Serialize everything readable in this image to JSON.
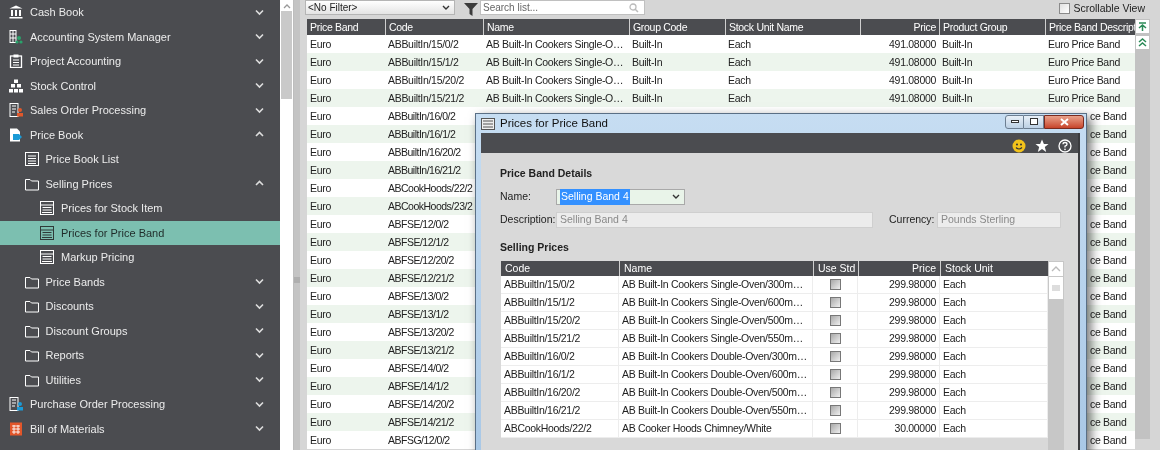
{
  "sidebar": {
    "items": [
      {
        "label": "Cash Book",
        "expanded": false,
        "selected": false
      },
      {
        "label": "Accounting System Manager",
        "expanded": false,
        "selected": false
      },
      {
        "label": "Project Accounting",
        "expanded": false,
        "selected": false
      },
      {
        "label": "Stock Control",
        "expanded": false,
        "selected": false
      },
      {
        "label": "Sales Order Processing",
        "expanded": false,
        "selected": false
      },
      {
        "label": "Price Book",
        "expanded": true,
        "selected": false,
        "children": [
          {
            "label": "Price Book List",
            "selected": false
          },
          {
            "label": "Selling Prices",
            "expanded": true,
            "selected": false,
            "children": [
              {
                "label": "Prices for Stock Item",
                "selected": false
              },
              {
                "label": "Prices for Price Band",
                "selected": true
              },
              {
                "label": "Markup Pricing",
                "selected": false
              }
            ]
          },
          {
            "label": "Price Bands",
            "expanded": false,
            "selected": false
          },
          {
            "label": "Discounts",
            "expanded": false,
            "selected": false
          },
          {
            "label": "Discount Groups",
            "expanded": false,
            "selected": false
          },
          {
            "label": "Reports",
            "expanded": false,
            "selected": false
          },
          {
            "label": "Utilities",
            "expanded": false,
            "selected": false
          }
        ]
      },
      {
        "label": "Purchase Order Processing",
        "expanded": false,
        "selected": false
      },
      {
        "label": "Bill of Materials",
        "expanded": false,
        "selected": false
      }
    ]
  },
  "toolbar": {
    "filter": "<No Filter>",
    "search": {
      "placeholder": "Search list..."
    },
    "scrollable_view": {
      "label": "Scrollable View",
      "checked": false
    }
  },
  "table": {
    "columns": [
      "Price Band",
      "Code",
      "Name",
      "Group Code",
      "Stock Unit Name",
      "Price",
      "Product Group",
      "Price Band Descript"
    ],
    "rows": [
      {
        "kind": "full",
        "cells": [
          "Euro",
          "ABBuiltIn/15/0/2",
          "AB Built-In Cookers Single-O…",
          "Built-In",
          "Each",
          "491.08000",
          "Built-In",
          "Euro Price Band"
        ]
      },
      {
        "kind": "full",
        "cells": [
          "Euro",
          "ABBuiltIn/15/1/2",
          "AB Built-In Cookers Single-O…",
          "Built-In",
          "Each",
          "491.08000",
          "Built-In",
          "Euro Price Band"
        ]
      },
      {
        "kind": "full",
        "cells": [
          "Euro",
          "ABBuiltIn/15/20/2",
          "AB Built-In Cookers Single-O…",
          "Built-In",
          "Each",
          "491.08000",
          "Built-In",
          "Euro Price Band"
        ]
      },
      {
        "kind": "full",
        "cells": [
          "Euro",
          "ABBuiltIn/15/21/2",
          "AB Built-In Cookers Single-O…",
          "Built-In",
          "Each",
          "491.08000",
          "Built-In",
          "Euro Price Band"
        ]
      },
      {
        "kind": "covered",
        "cells": [
          "Euro",
          "ABBuiltIn/16/0/2",
          "ce Band"
        ]
      },
      {
        "kind": "covered",
        "cells": [
          "Euro",
          "ABBuiltIn/16/1/2",
          "ce Band"
        ]
      },
      {
        "kind": "covered",
        "cells": [
          "Euro",
          "ABBuiltIn/16/20/2",
          "ce Band"
        ]
      },
      {
        "kind": "covered",
        "cells": [
          "Euro",
          "ABBuiltIn/16/21/2",
          "ce Band"
        ]
      },
      {
        "kind": "covered",
        "cells": [
          "Euro",
          "ABCookHoods/22/2",
          "ce Band"
        ]
      },
      {
        "kind": "covered",
        "cells": [
          "Euro",
          "ABCookHoods/23/2",
          "ce Band"
        ]
      },
      {
        "kind": "covered",
        "cells": [
          "Euro",
          "ABFSE/12/0/2",
          "ce Band"
        ]
      },
      {
        "kind": "covered",
        "cells": [
          "Euro",
          "ABFSE/12/1/2",
          "ce Band"
        ]
      },
      {
        "kind": "covered",
        "cells": [
          "Euro",
          "ABFSE/12/20/2",
          "ce Band"
        ]
      },
      {
        "kind": "covered",
        "cells": [
          "Euro",
          "ABFSE/12/21/2",
          "ce Band"
        ]
      },
      {
        "kind": "covered",
        "cells": [
          "Euro",
          "ABFSE/13/0/2",
          "ce Band"
        ]
      },
      {
        "kind": "covered",
        "cells": [
          "Euro",
          "ABFSE/13/1/2",
          "ce Band"
        ]
      },
      {
        "kind": "covered",
        "cells": [
          "Euro",
          "ABFSE/13/20/2",
          "ce Band"
        ]
      },
      {
        "kind": "covered",
        "cells": [
          "Euro",
          "ABFSE/13/21/2",
          "ce Band"
        ]
      },
      {
        "kind": "covered",
        "cells": [
          "Euro",
          "ABFSE/14/0/2",
          "ce Band"
        ]
      },
      {
        "kind": "covered",
        "cells": [
          "Euro",
          "ABFSE/14/1/2",
          "ce Band"
        ]
      },
      {
        "kind": "covered",
        "cells": [
          "Euro",
          "ABFSE/14/20/2",
          "ce Band"
        ]
      },
      {
        "kind": "covered",
        "cells": [
          "Euro",
          "ABFSE/14/21/2",
          "ce Band"
        ]
      },
      {
        "kind": "covered",
        "cells": [
          "Euro",
          "ABFSG/12/0/2",
          "ce Band"
        ]
      }
    ]
  },
  "dialog": {
    "title": "Prices for Price Band",
    "section_details": "Price Band Details",
    "name": {
      "label": "Name:",
      "value": "Selling Band 4",
      "text_selected": true
    },
    "description": {
      "label": "Description:",
      "value": "Selling Band 4"
    },
    "currency": {
      "label": "Currency:",
      "value": "Pounds Sterling"
    },
    "section_prices": "Selling Prices",
    "columns": [
      "Code",
      "Name",
      "Use Std",
      "Price",
      "Stock Unit"
    ],
    "rows": [
      {
        "code": "ABBuiltIn/15/0/2",
        "name": "AB Built-In Cookers Single-Oven/300m…",
        "use_std": false,
        "price": "299.98000",
        "unit": "Each"
      },
      {
        "code": "ABBuiltIn/15/1/2",
        "name": "AB Built-In Cookers Single-Oven/600m…",
        "use_std": false,
        "price": "299.98000",
        "unit": "Each"
      },
      {
        "code": "ABBuiltIn/15/20/2",
        "name": "AB Built-In Cookers Single-Oven/500m…",
        "use_std": false,
        "price": "299.98000",
        "unit": "Each"
      },
      {
        "code": "ABBuiltIn/15/21/2",
        "name": "AB Built-In Cookers Single-Oven/550m…",
        "use_std": false,
        "price": "299.98000",
        "unit": "Each"
      },
      {
        "code": "ABBuiltIn/16/0/2",
        "name": "AB Built-In Cookers Double-Oven/300m…",
        "use_std": false,
        "price": "299.98000",
        "unit": "Each"
      },
      {
        "code": "ABBuiltIn/16/1/2",
        "name": "AB Built-In Cookers Double-Oven/600m…",
        "use_std": false,
        "price": "299.98000",
        "unit": "Each"
      },
      {
        "code": "ABBuiltIn/16/20/2",
        "name": "AB Built-In Cookers Double-Oven/500m…",
        "use_std": false,
        "price": "299.98000",
        "unit": "Each"
      },
      {
        "code": "ABBuiltIn/16/21/2",
        "name": "AB Built-In Cookers Double-Oven/550m…",
        "use_std": false,
        "price": "299.98000",
        "unit": "Each"
      },
      {
        "code": "ABCookHoods/22/2",
        "name": "AB Cooker Hoods Chimney/White",
        "use_std": false,
        "price": "30.00000",
        "unit": "Each"
      }
    ]
  }
}
